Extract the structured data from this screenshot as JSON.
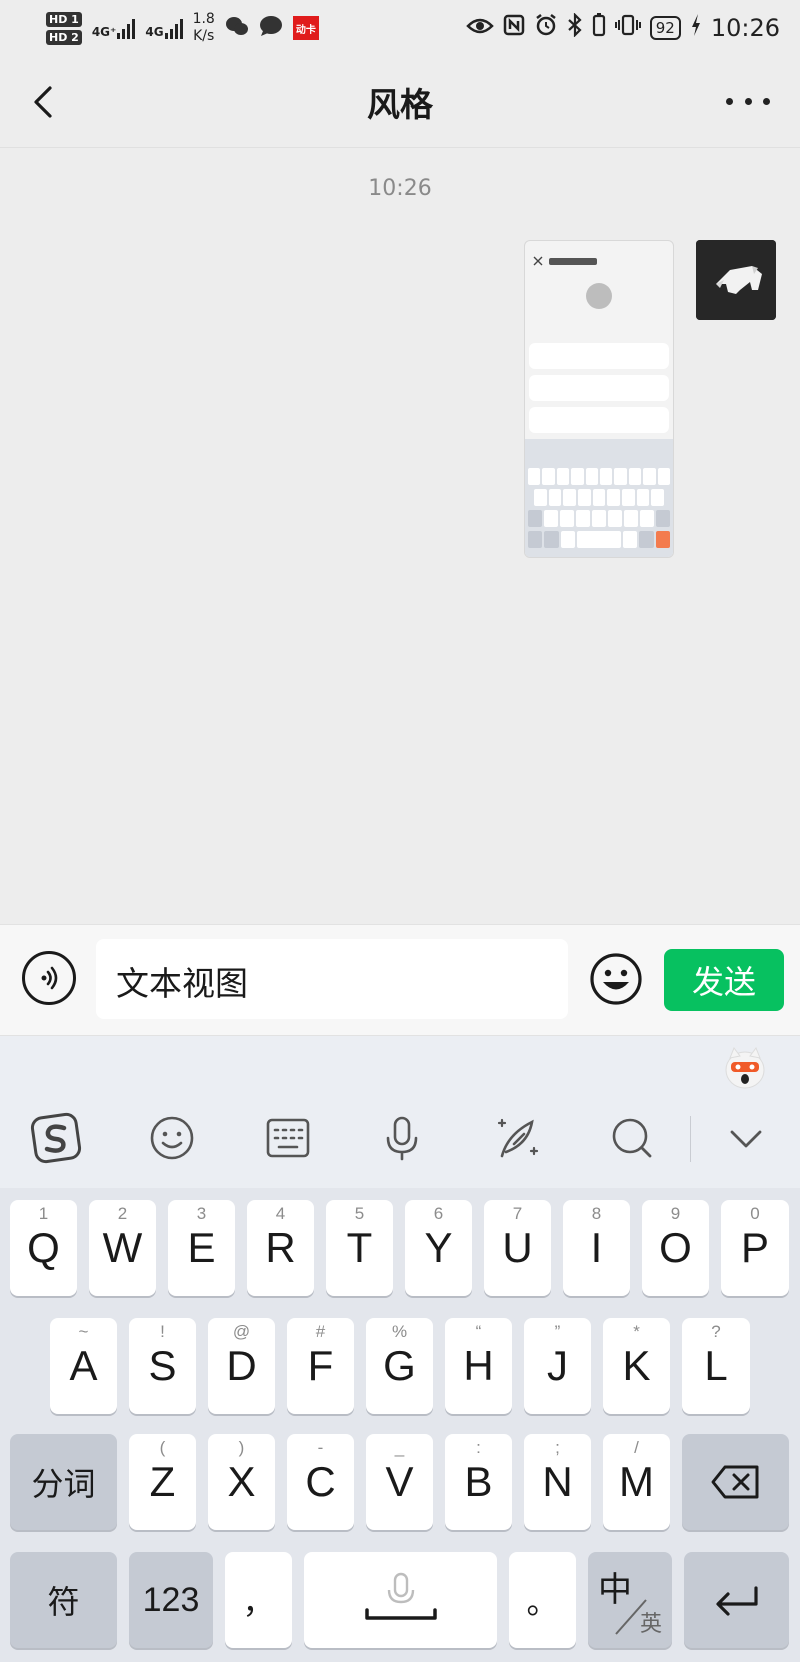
{
  "status_bar": {
    "hd1": "HD 1",
    "hd2": "HD 2",
    "net1": "4G⁺",
    "net2": "4G",
    "speed_value": "1.8",
    "speed_unit": "K/s",
    "app_badge": "动卡",
    "battery": "92",
    "time": "10:26"
  },
  "header": {
    "title": "风格"
  },
  "chat": {
    "timestamp": "10:26"
  },
  "input_bar": {
    "text": "文本视图",
    "send_label": "发送"
  },
  "keyboard": {
    "row1": [
      {
        "main": "Q",
        "sub": "1"
      },
      {
        "main": "W",
        "sub": "2"
      },
      {
        "main": "E",
        "sub": "3"
      },
      {
        "main": "R",
        "sub": "4"
      },
      {
        "main": "T",
        "sub": "5"
      },
      {
        "main": "Y",
        "sub": "6"
      },
      {
        "main": "U",
        "sub": "7"
      },
      {
        "main": "I",
        "sub": "8"
      },
      {
        "main": "O",
        "sub": "9"
      },
      {
        "main": "P",
        "sub": "0"
      }
    ],
    "row2": [
      {
        "main": "A",
        "sub": "~"
      },
      {
        "main": "S",
        "sub": "!"
      },
      {
        "main": "D",
        "sub": "@"
      },
      {
        "main": "F",
        "sub": "#"
      },
      {
        "main": "G",
        "sub": "%"
      },
      {
        "main": "H",
        "sub": "“"
      },
      {
        "main": "J",
        "sub": "”"
      },
      {
        "main": "K",
        "sub": "*"
      },
      {
        "main": "L",
        "sub": "?"
      }
    ],
    "row3": [
      {
        "main": "Z",
        "sub": "("
      },
      {
        "main": "X",
        "sub": ")"
      },
      {
        "main": "C",
        "sub": "-"
      },
      {
        "main": "V",
        "sub": "_"
      },
      {
        "main": "B",
        "sub": ":"
      },
      {
        "main": "N",
        "sub": ";"
      },
      {
        "main": "M",
        "sub": "/"
      }
    ],
    "fenci": "分词",
    "fu": "符",
    "num": "123",
    "comma": "，",
    "period": "。",
    "zh": "中",
    "en": "英"
  },
  "icons": {
    "back": "chevron-left-icon",
    "more": "more-icon",
    "voice": "voice-icon",
    "emoji": "emoji-icon",
    "delete": "backspace-icon",
    "enter": "enter-icon"
  },
  "colors": {
    "send": "#07c160",
    "background": "#ededed",
    "keyboard": "#e3e6ec"
  }
}
